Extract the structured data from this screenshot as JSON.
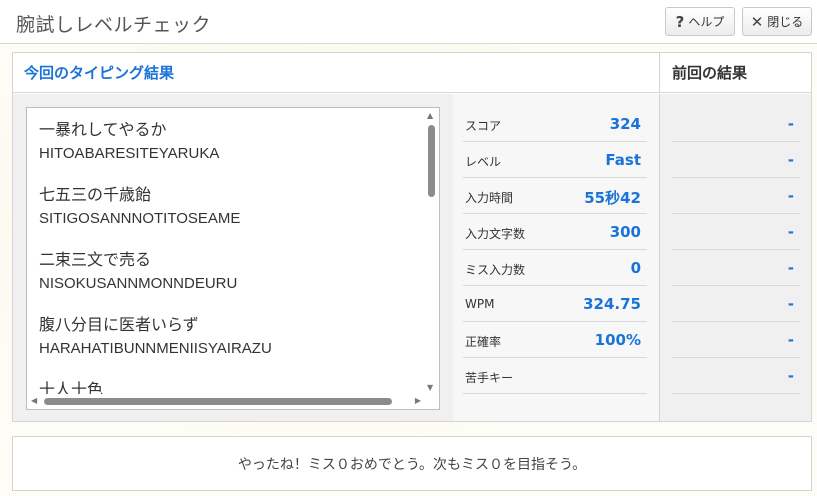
{
  "header": {
    "title": "腕試しレベルチェック",
    "help_label": "ヘルプ",
    "help_icon": "?",
    "close_label": "閉じる",
    "close_icon": "✕"
  },
  "panel": {
    "current_heading": "今回のタイピング結果",
    "previous_heading": "前回の結果"
  },
  "word_list": [
    {
      "jp": "一暴れしてやるか",
      "romaji": "HITOABARESITEYARUKA"
    },
    {
      "jp": "七五三の千歳飴",
      "romaji": "SITIGOSANNNOTITOSEAME"
    },
    {
      "jp": "二束三文で売る",
      "romaji": "NISOKUSANNMONNDEURU"
    },
    {
      "jp": "腹八分目に医者いらず",
      "romaji": "HARAHATIBUNNMENIISYAIRAZU"
    },
    {
      "jp": "十人十色",
      "romaji": ""
    }
  ],
  "stats": [
    {
      "label": "スコア",
      "value": "324",
      "prev": "-"
    },
    {
      "label": "レベル",
      "value": "Fast",
      "prev": "-"
    },
    {
      "label": "入力時間",
      "value": "55秒42",
      "prev": "-"
    },
    {
      "label": "入力文字数",
      "value": "300",
      "prev": "-"
    },
    {
      "label": "ミス入力数",
      "value": "0",
      "prev": "-"
    },
    {
      "label": "WPM",
      "value": "324.75",
      "prev": "-"
    },
    {
      "label": "正確率",
      "value": "100%",
      "prev": "-"
    },
    {
      "label": "苦手キー",
      "value": "",
      "prev": "-"
    }
  ],
  "message": "やったね！ミス０おめでとう。次もミス０を目指そう。",
  "colors": {
    "accent": "#1a73d9"
  }
}
